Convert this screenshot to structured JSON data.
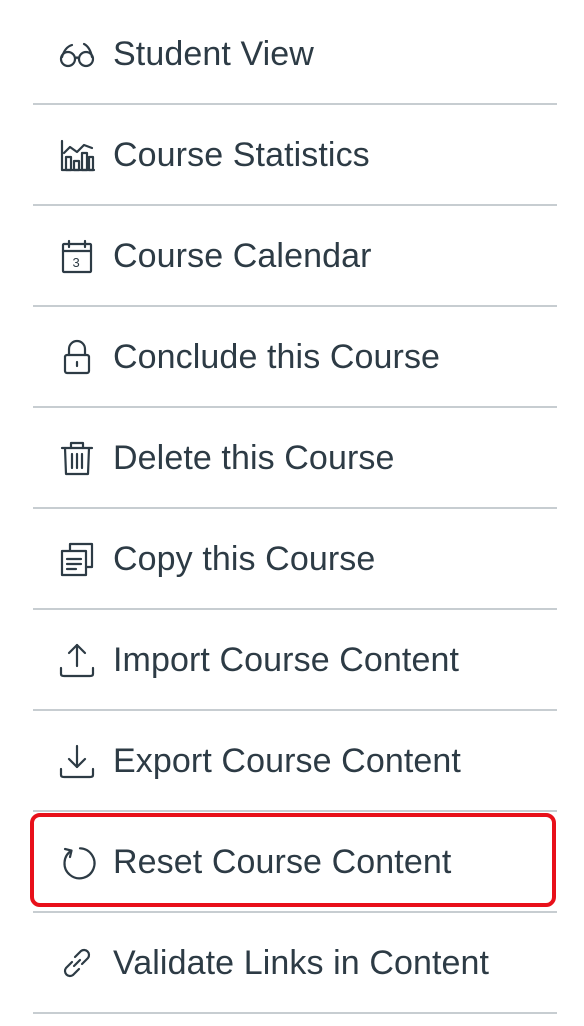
{
  "menu": {
    "items": [
      {
        "label": "Student View",
        "icon": "glasses-icon"
      },
      {
        "label": "Course Statistics",
        "icon": "statistics-icon"
      },
      {
        "label": "Course Calendar",
        "icon": "calendar-icon",
        "icon_text": "3"
      },
      {
        "label": "Conclude this Course",
        "icon": "lock-icon"
      },
      {
        "label": "Delete this Course",
        "icon": "trash-icon"
      },
      {
        "label": "Copy this Course",
        "icon": "copy-icon"
      },
      {
        "label": "Import Course Content",
        "icon": "upload-icon"
      },
      {
        "label": "Export Course Content",
        "icon": "download-icon"
      },
      {
        "label": "Reset Course Content",
        "icon": "reset-icon",
        "highlighted": true
      },
      {
        "label": "Validate Links in Content",
        "icon": "link-icon"
      }
    ]
  },
  "colors": {
    "text": "#2d3b45",
    "divider": "#c7cdd1",
    "highlight_border": "#e8101a"
  }
}
